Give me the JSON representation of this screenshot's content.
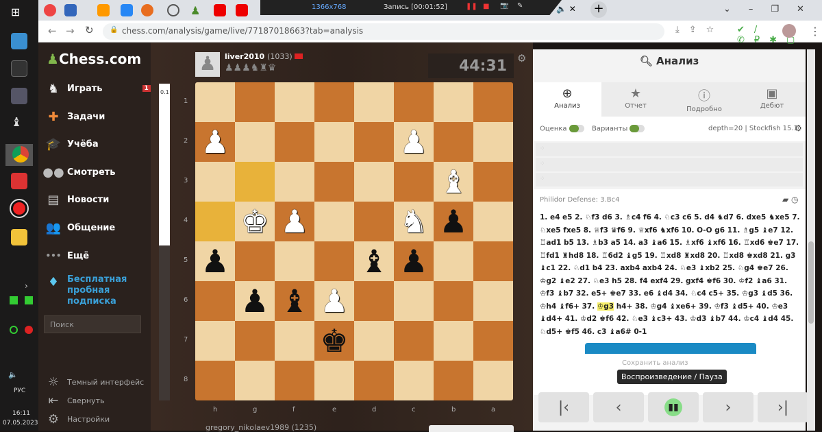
{
  "browser": {
    "url": "chess.com/analysis/game/live/77187018663?tab=analysis",
    "recorder_resolution": "1366x768",
    "recorder_status": "Запись [00:01:52]"
  },
  "taskbar": {
    "lang": "РУС",
    "time": "16:11",
    "date": "07.05.2023"
  },
  "sidebar": {
    "logo": "Chess.com",
    "items": [
      {
        "label": "Играть",
        "badge": "1"
      },
      {
        "label": "Задачи"
      },
      {
        "label": "Учёба"
      },
      {
        "label": "Смотреть"
      },
      {
        "label": "Новости"
      },
      {
        "label": "Общение"
      },
      {
        "label": "Ещё"
      }
    ],
    "promo": "Бесплатная пробная подписка",
    "search_placeholder": "Поиск",
    "bottom": [
      "Темный интерфейс",
      "Свернуть",
      "Настройки"
    ]
  },
  "top_player": {
    "name": "liver2010",
    "rating": "(1033)",
    "clock": "44:31",
    "captured": "♟♟♟♞♜♛"
  },
  "bottom_player": {
    "name": "gregory_nikolaev1989",
    "rating": "(1235)"
  },
  "eval": "0.1",
  "board": {
    "files": [
      "h",
      "g",
      "f",
      "e",
      "d",
      "c",
      "b",
      "a"
    ],
    "ranks": [
      "1",
      "2",
      "3",
      "4",
      "5",
      "6",
      "7",
      "8"
    ],
    "rows": [
      [
        "",
        "",
        "",
        "",
        "",
        "",
        "",
        ""
      ],
      [
        "wp",
        "",
        "",
        "",
        "",
        "wp",
        "",
        ""
      ],
      [
        "",
        "",
        "",
        "",
        "",
        "",
        "wb",
        ""
      ],
      [
        "",
        "wk",
        "wp",
        "",
        "",
        "wn",
        "bp",
        ""
      ],
      [
        "bp",
        "",
        "",
        "",
        "bb",
        "bp",
        "",
        ""
      ],
      [
        "",
        "bp",
        "bb",
        "wp",
        "",
        "",
        "",
        ""
      ],
      [
        "",
        "",
        "",
        "bk",
        "",
        "",
        "",
        ""
      ],
      [
        "",
        "",
        "",
        "",
        "",
        "",
        "",
        ""
      ]
    ],
    "highlights": [
      "1,2",
      "0,3"
    ]
  },
  "panel": {
    "title": "Анализ",
    "tabs": [
      "Анализ",
      "Отчет",
      "Подробно",
      "Дебют"
    ],
    "toggle_eval": "Оценка",
    "toggle_lines": "Варианты",
    "engine": "depth=20 | Stockfish 15.1",
    "opening": "Philidor Defense: 3.Bc4",
    "moves_before": "1. e4 e5 2. ♘f3 d6 3. ♗c4 f6 4. ♘c3 c6 5. d4 ♞d7 6. dxe5 ♞xe5 7. ♘xe5 fxe5 8. ♕f3 ♛f6 9. ♕xf6 ♞xf6 10. O-O g6 11. ♗g5 ♝e7 12. ♖ad1 b5 13. ♗b3 a5 14. a3 ♝a6 15. ♗xf6 ♝xf6 16. ♖xd6 ♚e7 17. ♖fd1 ♜hd8 18. ♖6d2 ♝g5 19. ♖xd8 ♜xd8 20. ♖xd8 ♚xd8 21. g3 ♝c1 22. ♘d1 b4 23. axb4 axb4 24. ♘e3 ♝xb2 25. ♘g4 ♚e7 26. ♔g2 ♝e2 27. ♘e3 h5 28. f4 exf4 29. gxf4 ♚f6 30. ♔f2 ♝a6 31. ♔f3 ♝b7 32. e5+ ♚e7 33. e6 ♝d4 34. ♘c4 c5+ 35. ♔g3 ♝d5 36. ♔h4 ♝f6+ 37.",
    "current": "♔g3",
    "moves_after": " h4+ 38. ♔g4 ♝xe6+ 39. ♔f3 ♝d5+ 40. ♔e3 ♝d4+ 41. ♔d2 ♚f6 42. ♘e3 ♝c3+ 43. ♔d3 ♝b7 44. ♔c4 ♝d4 45. ♘d5+ ♚f5 46. c3 ♝a6# 0-1",
    "save_label": "Сохранить анализ",
    "tooltip": "Воспроизведение / Пауза"
  }
}
